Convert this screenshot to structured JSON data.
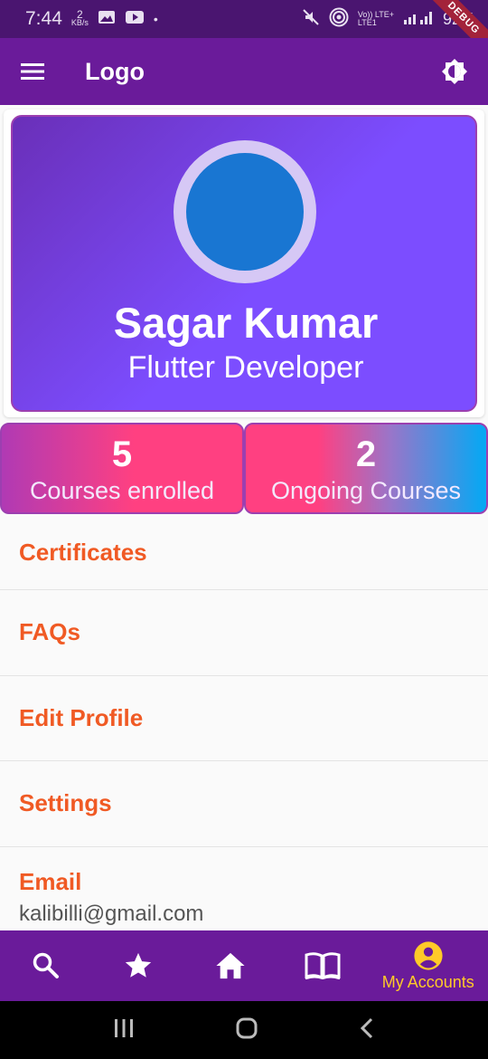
{
  "status_bar": {
    "time": "7:44",
    "net_speed": "2",
    "net_unit": "KB/s",
    "carrier_top": "Vo)) LTE+",
    "carrier_bottom": "LTE1",
    "battery": "92%",
    "debug": "DEBUG"
  },
  "app_bar": {
    "title": "Logo",
    "menu_icon": "hamburger-menu-icon",
    "theme_icon": "brightness-icon"
  },
  "profile": {
    "name": "Sagar Kumar",
    "role": "Flutter Developer",
    "avatar_color": "#1976d2"
  },
  "stats": [
    {
      "value": "5",
      "label": "Courses enrolled"
    },
    {
      "value": "2",
      "label": "Ongoing Courses"
    }
  ],
  "menu": {
    "items": [
      "Certificates",
      "FAQs",
      "Edit Profile",
      "Settings"
    ],
    "email_label": "Email",
    "email_value": "kalibilli@gmail.com"
  },
  "bottom_nav": {
    "items": [
      {
        "icon": "search-icon"
      },
      {
        "icon": "star-icon"
      },
      {
        "icon": "home-icon"
      },
      {
        "icon": "book-icon"
      },
      {
        "icon": "account-circle-icon",
        "label": "My Accounts",
        "active": true
      }
    ]
  },
  "colors": {
    "app_bar": "#6a1b9a",
    "accent_text": "#f05a24",
    "active_nav": "#ffca28"
  }
}
